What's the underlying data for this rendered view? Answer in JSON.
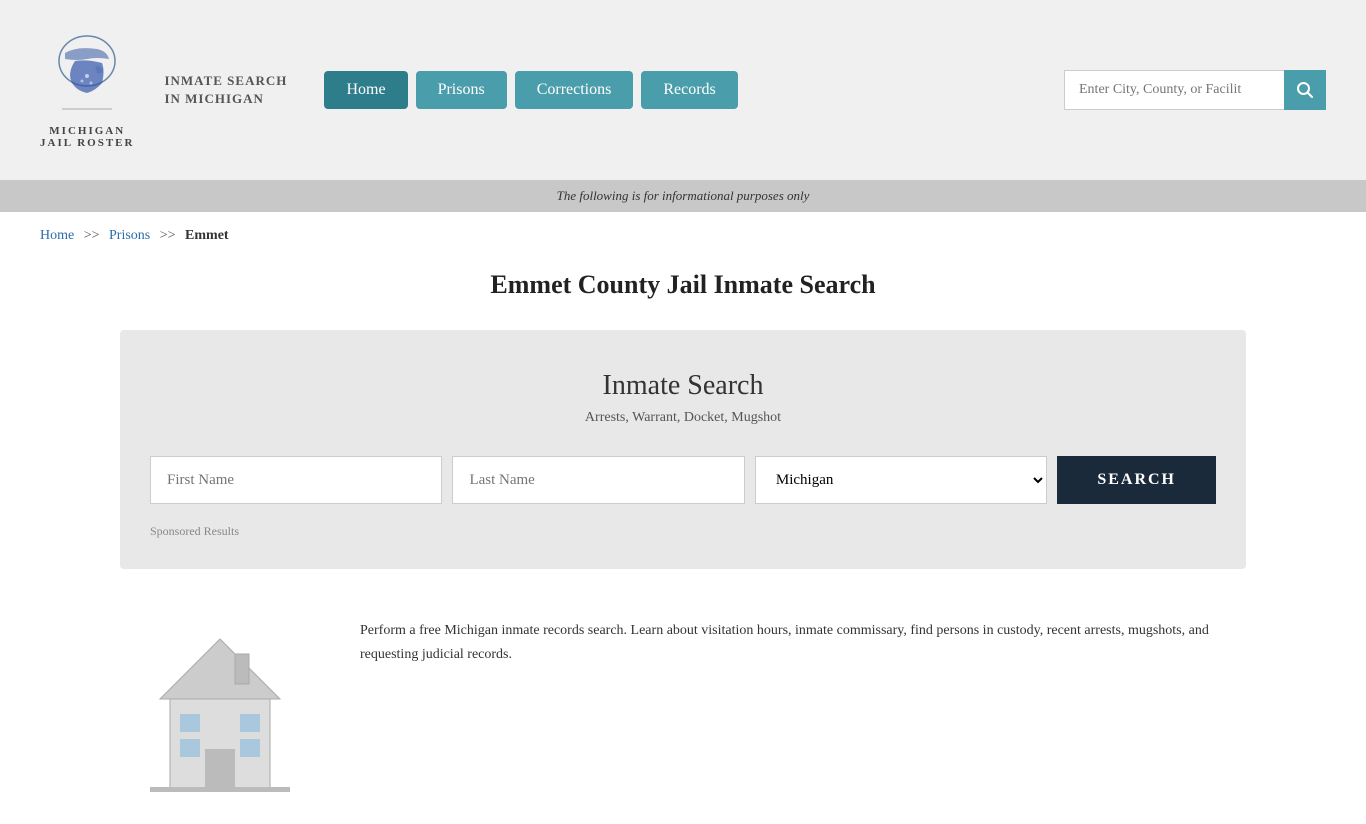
{
  "header": {
    "site_name_line1": "MICHIGAN",
    "site_name_line2": "JAIL ROSTER",
    "site_title": "INMATE SEARCH IN MICHIGAN",
    "nav": [
      {
        "label": "Home",
        "active": true
      },
      {
        "label": "Prisons",
        "active": false
      },
      {
        "label": "Corrections",
        "active": false
      },
      {
        "label": "Records",
        "active": false
      }
    ],
    "search_placeholder": "Enter City, County, or Facilit"
  },
  "info_bar": {
    "text": "The following is for informational purposes only"
  },
  "breadcrumb": {
    "home": "Home",
    "sep1": ">>",
    "prisons": "Prisons",
    "sep2": ">>",
    "current": "Emmet"
  },
  "page_title": "Emmet County Jail Inmate Search",
  "search_box": {
    "title": "Inmate Search",
    "subtitle": "Arrests, Warrant, Docket, Mugshot",
    "first_name_placeholder": "First Name",
    "last_name_placeholder": "Last Name",
    "state_default": "Michigan",
    "submit_label": "SEARCH",
    "sponsored_label": "Sponsored Results"
  },
  "bottom_text": "Perform a free Michigan inmate records search. Learn about visitation hours, inmate commissary, find persons in custody, recent arrests, mugshots, and requesting judicial records."
}
